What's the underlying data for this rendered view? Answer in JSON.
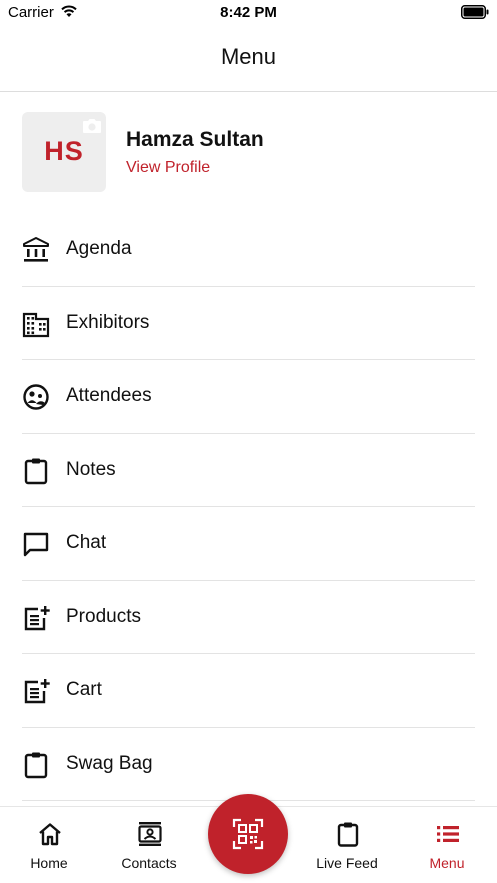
{
  "status_bar": {
    "carrier": "Carrier",
    "time": "8:42 PM"
  },
  "nav": {
    "title": "Menu"
  },
  "profile": {
    "initials": "HS",
    "name": "Hamza Sultan",
    "view_profile": "View Profile"
  },
  "menu": {
    "items": [
      {
        "label": "Agenda",
        "icon": "bank-icon"
      },
      {
        "label": "Exhibitors",
        "icon": "building-icon"
      },
      {
        "label": "Attendees",
        "icon": "attendees-icon"
      },
      {
        "label": "Notes",
        "icon": "clipboard-icon"
      },
      {
        "label": "Chat",
        "icon": "chat-bubble-icon"
      },
      {
        "label": "Products",
        "icon": "post-add-icon"
      },
      {
        "label": "Cart",
        "icon": "post-add-icon"
      },
      {
        "label": "Swag Bag",
        "icon": "clipboard-icon"
      }
    ]
  },
  "tab_bar": {
    "tabs": [
      {
        "label": "Home",
        "icon": "home-icon"
      },
      {
        "label": "Contacts",
        "icon": "contacts-icon"
      },
      {
        "label": "Live Feed",
        "icon": "clipboard-icon"
      },
      {
        "label": "Menu",
        "icon": "menu-list-icon"
      }
    ],
    "active": "Menu",
    "scan_icon": "qr-code-icon"
  },
  "colors": {
    "accent": "#c0222b",
    "text": "#111111",
    "divider": "#e3e3e3",
    "avatar_bg": "#eeeeee"
  }
}
